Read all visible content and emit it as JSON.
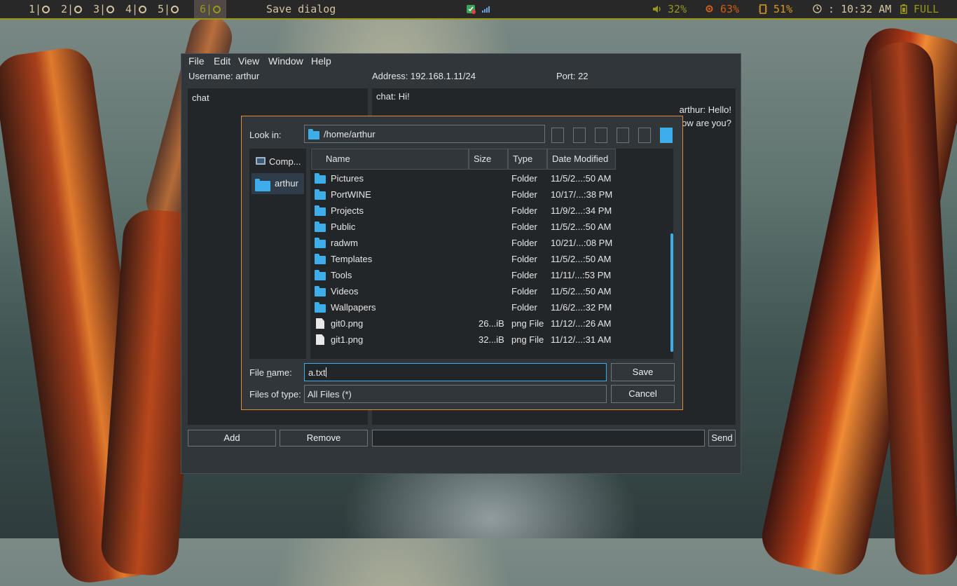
{
  "topbar": {
    "workspaces": [
      "1",
      "2",
      "3",
      "4",
      "5",
      "6"
    ],
    "active_workspace": "6",
    "window_title": "Save dialog",
    "volume": "32%",
    "cpu": "63%",
    "memory": "51%",
    "clock": ": 10:32 AM",
    "battery": "FULL",
    "colors": {
      "accent": "#98971a",
      "text": "#d5c4a1",
      "bar_bg": "#282828"
    }
  },
  "app": {
    "menu": [
      "File",
      "Edit",
      "View",
      "Window",
      "Help"
    ],
    "username_label": "Username: arthur",
    "address_label": "Address: 192.168.1.11/24",
    "port_label": "Port: 22",
    "chat_list": [
      "chat"
    ],
    "messages": [
      {
        "text": "chat: Hi!",
        "side": "left"
      },
      {
        "text": "arthur: Hello!",
        "side": "right"
      },
      {
        "text": "ow are you?",
        "side": "right"
      }
    ],
    "add_label": "Add",
    "remove_label": "Remove",
    "send_label": "Send",
    "message_input": ""
  },
  "dialog": {
    "look_in_label": "Look in:",
    "path": "/home/arthur",
    "places": [
      {
        "label": "Comp...",
        "icon": "computer-icon",
        "selected": false
      },
      {
        "label": "arthur",
        "icon": "folder-icon",
        "selected": true
      }
    ],
    "columns": [
      "Name",
      "Size",
      "Type",
      "Date Modified"
    ],
    "rows": [
      {
        "name": "Pictures",
        "size": "",
        "type": "Folder",
        "date": "11/5/2...:50 AM",
        "kind": "folder"
      },
      {
        "name": "PortWINE",
        "size": "",
        "type": "Folder",
        "date": "10/17/...:38 PM",
        "kind": "folder"
      },
      {
        "name": "Projects",
        "size": "",
        "type": "Folder",
        "date": "11/9/2...:34 PM",
        "kind": "folder"
      },
      {
        "name": "Public",
        "size": "",
        "type": "Folder",
        "date": "11/5/2...:50 AM",
        "kind": "folder"
      },
      {
        "name": "radwm",
        "size": "",
        "type": "Folder",
        "date": "10/21/...:08 PM",
        "kind": "folder"
      },
      {
        "name": "Templates",
        "size": "",
        "type": "Folder",
        "date": "11/5/2...:50 AM",
        "kind": "folder"
      },
      {
        "name": "Tools",
        "size": "",
        "type": "Folder",
        "date": "11/11/...:53 PM",
        "kind": "folder"
      },
      {
        "name": "Videos",
        "size": "",
        "type": "Folder",
        "date": "11/5/2...:50 AM",
        "kind": "folder"
      },
      {
        "name": "Wallpapers",
        "size": "",
        "type": "Folder",
        "date": "11/6/2...:32 PM",
        "kind": "folder"
      },
      {
        "name": "git0.png",
        "size": "26...iB",
        "type": "png File",
        "date": "11/12/...:26 AM",
        "kind": "file"
      },
      {
        "name": "git1.png",
        "size": "32...iB",
        "type": "png File",
        "date": "11/12/...:31 AM",
        "kind": "file"
      }
    ],
    "file_name_label": "File name:",
    "file_name_value": "a.txt",
    "files_of_type_label": "Files of type:",
    "files_of_type_value": "All Files (*)",
    "save_label": "Save",
    "cancel_label": "Cancel",
    "colors": {
      "selection": "#3daee9",
      "border": "#e08a3c"
    }
  }
}
